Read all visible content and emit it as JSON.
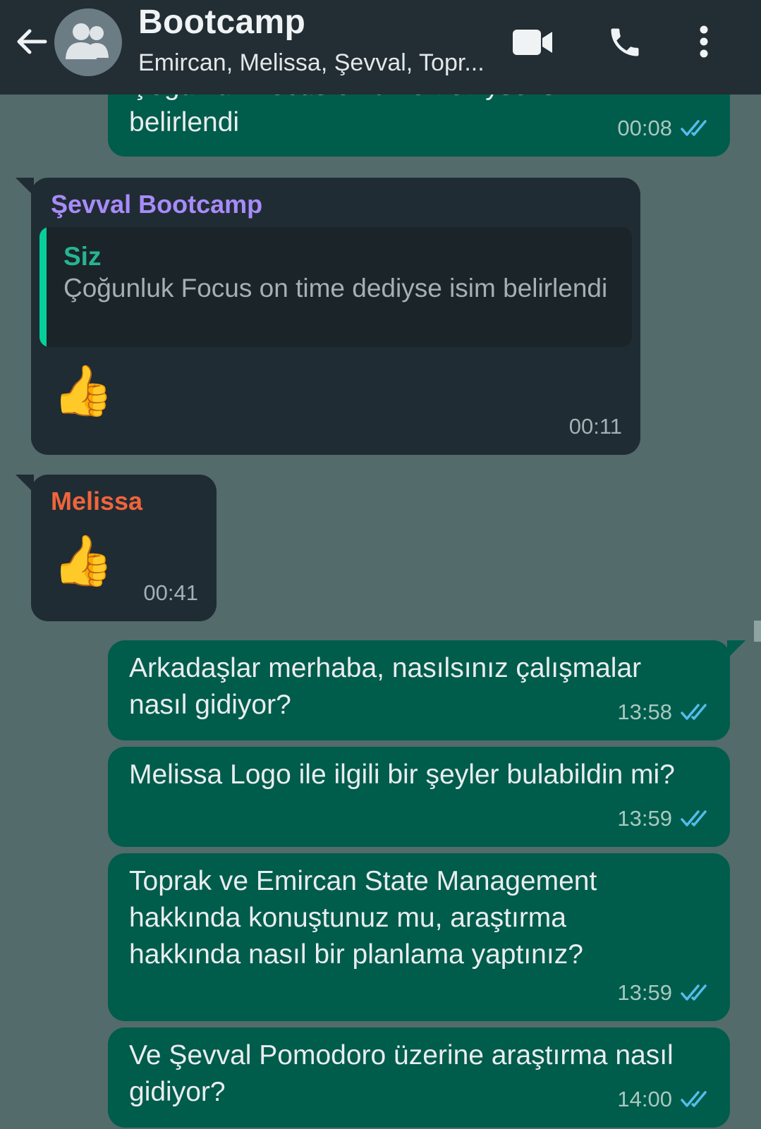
{
  "header": {
    "title": "Bootcamp",
    "subtitle": "Emircan, Melissa, Şevval, Topr..."
  },
  "messages": [
    {
      "kind": "outgoing",
      "partial_text": "Çoğunluk Focus on time dediyse isim",
      "text": "belirlendi",
      "time": "00:08",
      "status": "read"
    },
    {
      "kind": "incoming",
      "sender": "Şevval Bootcamp",
      "sender_color": "#a78bfa",
      "quote": {
        "name": "Siz",
        "text": "Çoğunluk Focus on time dediyse isim belirlendi"
      },
      "emoji": "👍",
      "time": "00:11"
    },
    {
      "kind": "incoming",
      "sender": "Melissa",
      "sender_color": "#f0643c",
      "emoji": "👍",
      "time": "00:41"
    },
    {
      "kind": "outgoing",
      "text": "Arkadaşlar merhaba, nasılsınız çalışmalar nasıl gidiyor?",
      "time": "13:58",
      "status": "read"
    },
    {
      "kind": "outgoing",
      "text": "Melissa Logo ile ilgili bir şeyler bulabildin mi?",
      "time": "13:59",
      "status": "read"
    },
    {
      "kind": "outgoing",
      "text": "Toprak ve Emircan State Management hakkında konuştunuz mu, araştırma hakkında nasıl bir planlama yaptınız?",
      "time": "13:59",
      "status": "read"
    },
    {
      "kind": "outgoing",
      "text": "Ve Şevval Pomodoro üzerine araştırma nasıl gidiyor?",
      "time": "14:00",
      "status": "read"
    }
  ],
  "icons": {
    "back": "arrow-left-icon",
    "avatar": "group-icon",
    "video": "video-camera-icon",
    "call": "phone-icon",
    "menu": "more-vertical-icon",
    "read_receipt": "double-check-icon"
  },
  "colors": {
    "header_bg": "#222d34",
    "chat_bg": "#536b6a",
    "outgoing_bubble": "#005c4b",
    "incoming_bubble": "#202c33",
    "read_tick": "#53bdeb"
  }
}
